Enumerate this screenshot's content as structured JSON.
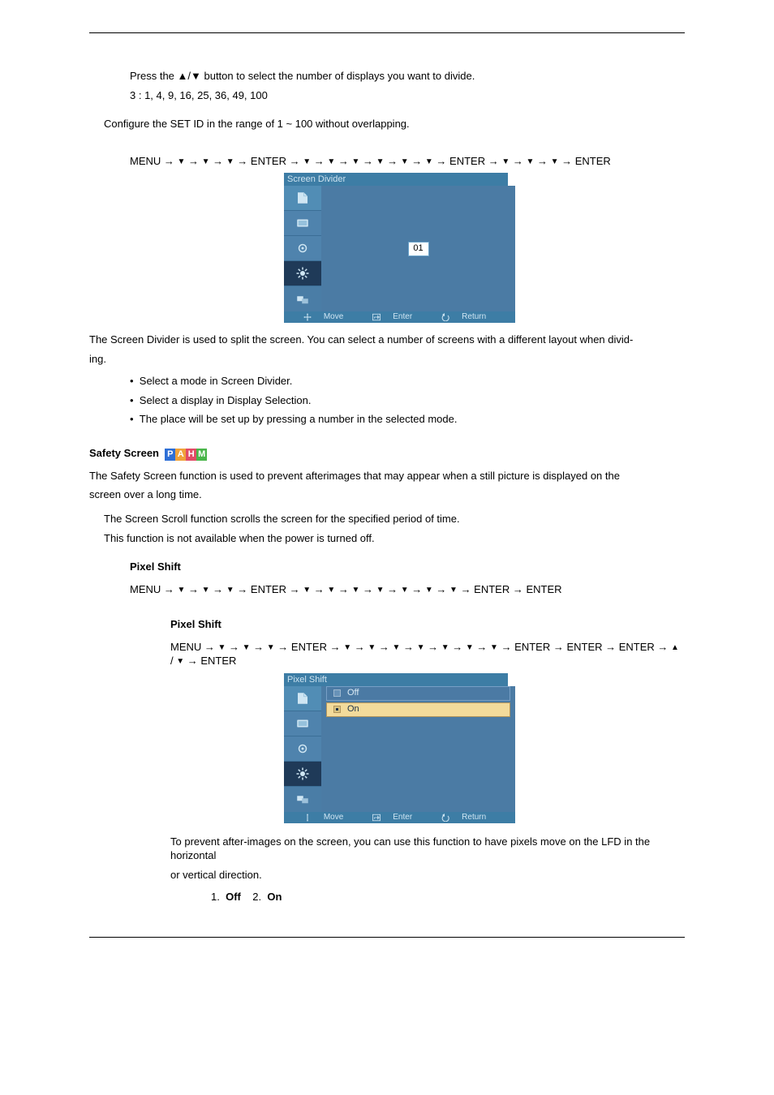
{
  "step_instr": "Press the ▲/▼ button to select the number of displays you want to divide.",
  "arrangements": "3 : 1, 4, 9, 16, 25, 36, 49, 100",
  "configure": "Configure the SET ID in the range of 1 ~ 100 without overlapping.",
  "menu_path_divider": "MENU →   ▼   →   ▼   →   ▼   → ENTER →   ▼   →   ▼   →   ▼   →   ▼   →   ▼   →   ▼   → ENTER →   ▼   →   ▼   →   ▼   → ENTER",
  "osd_divider": {
    "title": "Screen Divider",
    "value": "01",
    "footer_move": "Move",
    "footer_enter": "Enter",
    "footer_return": "Return"
  },
  "divider_desc_l1": "The Screen Divider is used to split the screen. You can select a number of screens with a different layout when divid-",
  "divider_desc_l2": "ing.",
  "divider_bullet1": "Select a mode in Screen Divider.",
  "divider_bullet2": "Select a display in Display Selection.",
  "divider_bullet3": "The place will be set up by pressing a number in the selected mode.",
  "safety_title": "Safety Screen",
  "safety_p1": "The Safety Screen function is used to prevent afterimages that may appear when a still picture is displayed on the",
  "safety_p2": "screen over a long time.",
  "safety_note_line1": "The Screen Scroll function scrolls the screen for the specified period of time.",
  "safety_note_line2": "This function is not available when the power is turned off.",
  "pixel_title": "Pixel Shift",
  "menu_path_pixel_1": "MENU →   ▼   →   ▼   →   ▼   → ENTER →   ▼   →   ▼   →   ▼   →   ▼   →   ▼   →   ▼   →   ▼   → ENTER → ENTER",
  "pixel_shift_sub": "Pixel Shift",
  "menu_path_pixel_2": "MENU →   ▼   →   ▼   →   ▼   → ENTER →   ▼   →   ▼   →   ▼   →   ▼   →   ▼   →   ▼   →   ▼   → ENTER → ENTER → ENTER →   ▲ / ▼   → ENTER",
  "osd_pixel": {
    "title": "Pixel Shift",
    "opt_off": "Off",
    "opt_on": "On",
    "footer_move": "Move",
    "footer_enter": "Enter",
    "footer_return": "Return"
  },
  "pixel_desc_l1": "To prevent after-images on the screen, you can use this function to have pixels move on the LFD in the horizontal",
  "pixel_desc_l2": "or vertical direction.",
  "pixel_opts_line": "1. Off  2. On"
}
